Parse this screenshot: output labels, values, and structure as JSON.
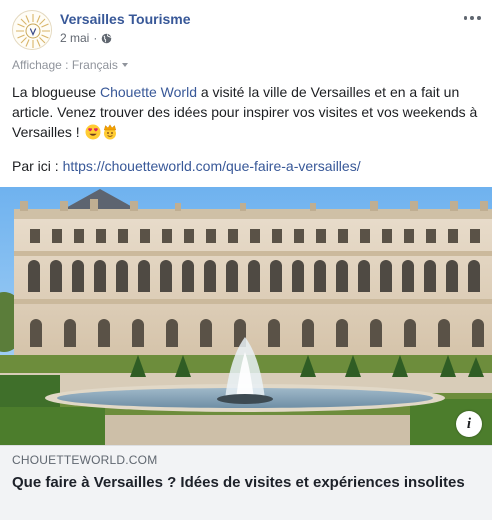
{
  "post": {
    "page_name": "Versailles Tourisme",
    "date": "2 mai",
    "separator": "·",
    "audience_icon": "globe-icon",
    "more_icon": "more-options-icon",
    "translate_label": "Affichage : Français",
    "body_start": "La blogueuse ",
    "mention": "Chouette World",
    "body_end": " a visité la ville de Versailles et en a fait un article. Venez trouver des idées pour inspirer vos visites et vos weekends à Versailles ! ",
    "emojis": [
      "heart-eyes-emoji",
      "crown-emoji"
    ],
    "link_intro": "Par ici : ",
    "link_url": "https://chouetteworld.com/que-faire-a-versailles/"
  },
  "preview": {
    "domain": "CHOUETTEWORLD.COM",
    "title": "Que faire à Versailles ? Idées de visites et expériences insolites",
    "info_icon": "info-icon",
    "image": "chateau-de-versailles-photo"
  },
  "colors": {
    "link": "#385898",
    "text": "#1c1e21",
    "muted": "#616770",
    "preview_bg": "#f2f3f5"
  }
}
